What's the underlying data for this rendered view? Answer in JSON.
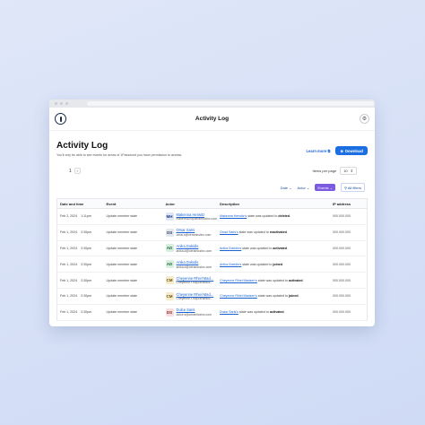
{
  "app": {
    "title": "Activity Log"
  },
  "page": {
    "heading": "Activity Log",
    "subtitle": "You'll only be able to see events for areas of 1Password you have permission to access.",
    "learn_more": "Learn more",
    "download": "Download"
  },
  "pagination": {
    "current": "1",
    "items_per_page_label": "Items per page",
    "items_per_page_value": "10"
  },
  "filters": {
    "date": "Date",
    "actor": "Actor",
    "events": "Events",
    "all_filters": "All filters"
  },
  "table": {
    "headers": {
      "date": "Date and time",
      "event": "Event",
      "actor": "Actor",
      "description": "Description",
      "ip": "IP address"
    },
    "rows": [
      {
        "date": "Feb 2, 2024",
        "time": "1:11pm",
        "event": "Update member state",
        "initials": "MH",
        "name": "Makenna Herwitz",
        "email": "makenna.h@ceramiczinc.com",
        "desc_link": "Makenna Herwitz's",
        "desc_mid": " state was updated to ",
        "desc_value": "deleted",
        "desc_end": ".",
        "ip": "000.000.000"
      },
      {
        "date": "Feb 1, 2024",
        "time": "2:30pm",
        "event": "Update member state",
        "initials": "OS",
        "name": "Omar Saris",
        "email": "omar.s@ceramiczinc.com",
        "desc_link": "Omar Saris's",
        "desc_mid": " state was updated to ",
        "desc_value": "reactivated",
        "desc_end": ".",
        "ip": "000.000.000"
      },
      {
        "date": "Feb 1, 2024",
        "time": "2:30pm",
        "event": "Update member state",
        "initials": "AD",
        "name": "Anika Dokidis",
        "email": "anika.d@ceramiczinc.com",
        "desc_link": "Anika Dokidis's",
        "desc_mid": " state was updated to ",
        "desc_value": "activated",
        "desc_end": ".",
        "ip": "000.000.000"
      },
      {
        "date": "Feb 1, 2024",
        "time": "2:30pm",
        "event": "Update member state",
        "initials": "AD",
        "name": "Anika Dokidis",
        "email": "anika.d@ceramiczinc.com",
        "desc_link": "Anika Dokidis's",
        "desc_mid": " state was updated to ",
        "desc_value": "joined",
        "desc_end": ".",
        "ip": "000.000.000"
      },
      {
        "date": "Feb 1, 2024",
        "time": "2:30pm",
        "event": "Update member state",
        "initials": "CM",
        "name": "Cheyenne Rhiel Mad...",
        "email": "Cheyenne.r.m@ceramicz...",
        "desc_link": "Cheyenne Rhiel Madsen's",
        "desc_mid": " state was updated to ",
        "desc_value": "activated",
        "desc_end": ".",
        "ip": "000.000.000"
      },
      {
        "date": "Feb 1, 2024",
        "time": "2:30pm",
        "event": "Update member state",
        "initials": "CM",
        "name": "Cheyenne Rhiel Mad...",
        "email": "Cheyenne.r.m@ceramicz...",
        "desc_link": "Cheyenne Rhiel Madsen's",
        "desc_mid": " state was updated to ",
        "desc_value": "joined",
        "desc_end": ".",
        "ip": "000.000.000"
      },
      {
        "date": "Feb 1, 2024",
        "time": "2:30pm",
        "event": "Update member state",
        "initials": "DS",
        "name": "Dulce Saris",
        "email": "dulce.s@ceramiczinc.com",
        "desc_link": "Dulce Saris's",
        "desc_mid": " state was updated to ",
        "desc_value": "activated",
        "desc_end": ".",
        "ip": "000.000.000"
      }
    ]
  },
  "avatar_colors": {
    "MH": {
      "bg": "#dde6f7",
      "fg": "#1d3b7a"
    },
    "OS": {
      "bg": "#e3e8f0",
      "fg": "#2d3d5c"
    },
    "AD": {
      "bg": "#d8efe0",
      "fg": "#1f6b3a"
    },
    "CM": {
      "bg": "#f6ecc9",
      "fg": "#6a5210"
    },
    "DS": {
      "bg": "#f7dede",
      "fg": "#8a2626"
    }
  },
  "icons": {
    "logo": "1password-logo-icon",
    "settings": "gear-icon",
    "external": "external-link-icon",
    "download": "download-icon"
  }
}
